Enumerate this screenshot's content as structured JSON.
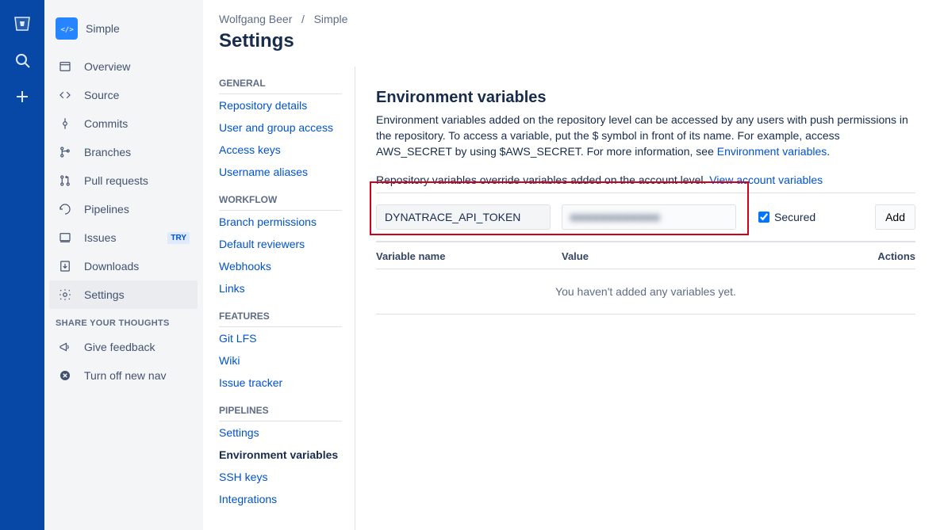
{
  "rail": {
    "product": "Bitbucket"
  },
  "project": {
    "name": "Simple"
  },
  "breadcrumb": {
    "owner": "Wolfgang Beer",
    "sep": "/",
    "repo": "Simple"
  },
  "page_title": "Settings",
  "sidebar": {
    "items": [
      {
        "label": "Overview"
      },
      {
        "label": "Source"
      },
      {
        "label": "Commits"
      },
      {
        "label": "Branches"
      },
      {
        "label": "Pull requests"
      },
      {
        "label": "Pipelines"
      },
      {
        "label": "Issues",
        "badge": "TRY"
      },
      {
        "label": "Downloads"
      },
      {
        "label": "Settings"
      }
    ],
    "share_header": "SHARE YOUR THOUGHTS",
    "feedback": "Give feedback",
    "turnoff": "Turn off new nav"
  },
  "settings_nav": {
    "general": {
      "header": "GENERAL",
      "items": [
        "Repository details",
        "User and group access",
        "Access keys",
        "Username aliases"
      ]
    },
    "workflow": {
      "header": "WORKFLOW",
      "items": [
        "Branch permissions",
        "Default reviewers",
        "Webhooks",
        "Links"
      ]
    },
    "features": {
      "header": "FEATURES",
      "items": [
        "Git LFS",
        "Wiki",
        "Issue tracker"
      ]
    },
    "pipelines": {
      "header": "PIPELINES",
      "items": [
        "Settings",
        "Environment variables",
        "SSH keys",
        "Integrations"
      ],
      "active": "Environment variables"
    }
  },
  "main": {
    "title": "Environment variables",
    "desc_prefix": "Environment variables added on the repository level can be accessed by any users with push permissions in the repository. To access a variable, put the $ symbol in front of its name. For example, access AWS_SECRET by using $AWS_SECRET. For more information, see ",
    "desc_link": "Environment variables",
    "desc_suffix": ".",
    "override_text": "Repository variables override variables added on the account level. ",
    "override_link": "View account variables",
    "input_name": "DYNATRACE_API_TOKEN",
    "input_value_masked": "■■■■■■■■■■■■",
    "secured_label": "Secured",
    "secured_checked": true,
    "add_label": "Add",
    "columns": {
      "name": "Variable name",
      "value": "Value",
      "actions": "Actions"
    },
    "empty_text": "You haven't added any variables yet."
  }
}
